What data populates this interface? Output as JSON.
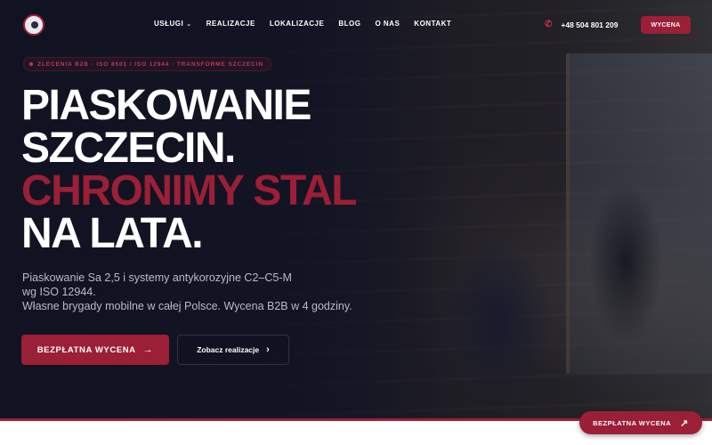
{
  "nav": {
    "menu": [
      {
        "label": "USŁUGI",
        "has_dropdown": true
      },
      {
        "label": "REALIZACJE"
      },
      {
        "label": "LOKALIZACJE"
      },
      {
        "label": "BLOG"
      },
      {
        "label": "O NAS"
      },
      {
        "label": "KONTAKT"
      }
    ],
    "phone": "+48 504 801 209",
    "cta_label": "WYCENA"
  },
  "hero": {
    "badge": "ZLECENIA B2B · ISO 8501 / ISO 12944 · TRANSFORME SZCZECIN",
    "headline": {
      "line1": "PIASKOWANIE",
      "line2": "SZCZECIN.",
      "line3_accent": "CHRONIMY STAL",
      "line4": "NA LATA."
    },
    "subtext": {
      "line1": "Piaskowanie Sa 2,5 i systemy antykorozyjne C2–C5-M",
      "line2": "wg ISO 12944.",
      "line3": "Własne brygady mobilne w całej Polsce. Wycena B2B w 4 godziny."
    },
    "primary_button": "BEZPŁATNA WYCENA",
    "secondary_button": "Zobacz realizacje"
  },
  "floating_cta": {
    "label": "BEZPŁATNA WYCENA"
  },
  "colors": {
    "accent": "#9b1f36",
    "background": "#111321",
    "badge_text": "#c3374f"
  },
  "icons": {
    "phone": "phone-icon",
    "arrow_right": "arrow-right-icon",
    "chevron_right": "chevron-right-icon",
    "arrow_up_right": "arrow-up-right-icon",
    "chevron_down": "chevron-down-icon"
  }
}
